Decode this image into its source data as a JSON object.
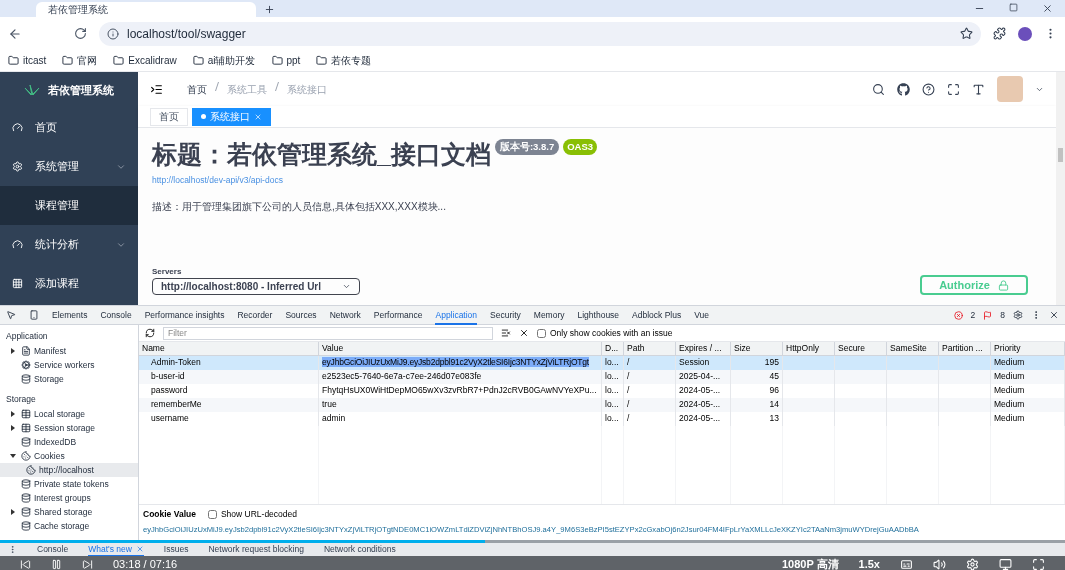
{
  "browser": {
    "tab_title": "若依管理系统",
    "address": "localhost/tool/swagger",
    "bookmarks": [
      "itcast",
      "官网",
      "Excalidraw",
      "ai辅助开发",
      "ppt",
      "若依专题"
    ]
  },
  "app": {
    "logo_title": "若依管理系统",
    "menu": [
      {
        "label": "首页",
        "kind": "item",
        "selected": false
      },
      {
        "label": "系统管理",
        "kind": "group",
        "selected": false
      },
      {
        "label": "课程管理",
        "kind": "child",
        "selected": true
      },
      {
        "label": "统计分析",
        "kind": "group",
        "selected": false
      },
      {
        "label": "添加课程",
        "kind": "item",
        "selected": false
      }
    ],
    "breadcrumb": [
      "首页",
      "系统工具",
      "系统接口"
    ],
    "tags": [
      {
        "label": "首页",
        "selected": false
      },
      {
        "label": "系统接口",
        "selected": true
      }
    ],
    "swagger": {
      "title": "标题：若依管理系统_接口文档",
      "version": "版本号:3.8.7",
      "spec": "OAS3",
      "url": "http://localhost/dev-api/v3/api-docs",
      "description": "描述：用于管理集团旗下公司的人员信息,具体包括XXX,XXX模块...",
      "servers_label": "Servers",
      "server": "http://localhost:8080 - Inferred Url",
      "authorize": "Authorize"
    }
  },
  "devtools": {
    "tabs": [
      {
        "label": "Elements",
        "selected": false
      },
      {
        "label": "Console",
        "selected": false
      },
      {
        "label": "Performance insights",
        "selected": false
      },
      {
        "label": "Recorder",
        "selected": false
      },
      {
        "label": "Sources",
        "selected": false
      },
      {
        "label": "Network",
        "selected": false
      },
      {
        "label": "Performance",
        "selected": false
      },
      {
        "label": "Application",
        "selected": true
      },
      {
        "label": "Security",
        "selected": false
      },
      {
        "label": "Memory",
        "selected": false
      },
      {
        "label": "Lighthouse",
        "selected": false
      },
      {
        "label": "Adblock Plus",
        "selected": false
      },
      {
        "label": "Vue",
        "selected": false
      }
    ],
    "errors": "2",
    "warnings": "8",
    "filter": {
      "placeholder": "Filter"
    },
    "issue_only": {
      "label": "Only show cookies with an issue",
      "checked": false
    },
    "sidebar": [
      {
        "heading": "Application",
        "items": [
          {
            "label": "Manifest",
            "kind": "expandable",
            "expanded": false
          },
          {
            "label": "Service workers",
            "kind": "leaf"
          },
          {
            "label": "Storage",
            "kind": "leaf"
          }
        ]
      },
      {
        "heading": "Storage",
        "items": [
          {
            "label": "Local storage",
            "kind": "expandable",
            "expanded": false
          },
          {
            "label": "Session storage",
            "kind": "expandable",
            "expanded": false
          },
          {
            "label": "IndexedDB",
            "kind": "leaf"
          },
          {
            "label": "Cookies",
            "kind": "expandable",
            "expanded": true,
            "children": [
              {
                "label": "http://localhost",
                "selected": true
              }
            ]
          },
          {
            "label": "Private state tokens",
            "kind": "leaf"
          },
          {
            "label": "Interest groups",
            "kind": "leaf"
          },
          {
            "label": "Shared storage",
            "kind": "expandable",
            "expanded": false
          },
          {
            "label": "Cache storage",
            "kind": "leaf"
          }
        ]
      }
    ],
    "columns": [
      "Name",
      "Value",
      "D...",
      "Path",
      "Expires / ...",
      "Size",
      "HttpOnly",
      "Secure",
      "SameSite",
      "Partition ...",
      "Priority"
    ],
    "rows": [
      {
        "name": "Admin-Token",
        "value": "eyJhbGciOiJIUzUxMiJ9.eyJsb2dpbl91c2VyX2tleSI6Ijc3NTYxZjViLTRjOTgt",
        "domain": "lo...",
        "path": "/",
        "expires": "Session",
        "size": "195",
        "priority": "Medium",
        "selected": true
      },
      {
        "name": "b-user-id",
        "value": "e2523ec5-7640-6e7a-c7ee-246d07e083fe",
        "domain": "lo...",
        "path": "/",
        "expires": "2025-04-...",
        "size": "45",
        "priority": "Medium",
        "selected": false
      },
      {
        "name": "password",
        "value": "FhytqHsUX0WiHtDepMO65wXv3zvRbR7+PdnJ2cRVB0GAwNVYeXPu...",
        "domain": "lo...",
        "path": "/",
        "expires": "2024-05-...",
        "size": "96",
        "priority": "Medium",
        "selected": false
      },
      {
        "name": "rememberMe",
        "value": "true",
        "domain": "lo...",
        "path": "/",
        "expires": "2024-05-...",
        "size": "14",
        "priority": "Medium",
        "selected": false
      },
      {
        "name": "username",
        "value": "admin",
        "domain": "lo...",
        "path": "/",
        "expires": "2024-05-...",
        "size": "13",
        "priority": "Medium",
        "selected": false
      }
    ],
    "cookie_value": {
      "label": "Cookie Value",
      "decode": {
        "label": "Show URL-decoded",
        "checked": false
      },
      "value": "eyJhbGciOiJIUzUxMiJ9.eyJsb2dpbl91c2VyX2tleSI6Ijc3NTYxZjViLTRjOTgtNDE0MC1iOWZmLTdiZDViZjNhNTBhOSJ9.a4Y_9M6S3eBzPI5stEZYPx2cGxabOj6n2Jsur04FM4IFpLrYaXMLLcJeXKZYIc2TAaNm3jmuWYDrejGuAADbBA"
    },
    "drawer": [
      {
        "label": "Console",
        "selected": false
      },
      {
        "label": "What's new",
        "selected": true
      },
      {
        "label": "Issues",
        "selected": false
      },
      {
        "label": "Network request blocking",
        "selected": false
      },
      {
        "label": "Network conditions",
        "selected": false
      }
    ]
  },
  "player": {
    "progress": {
      "level": 0.455
    },
    "time": "03:18 / 07:16",
    "quality": "1080P 高清",
    "speed": "1.5x"
  }
}
